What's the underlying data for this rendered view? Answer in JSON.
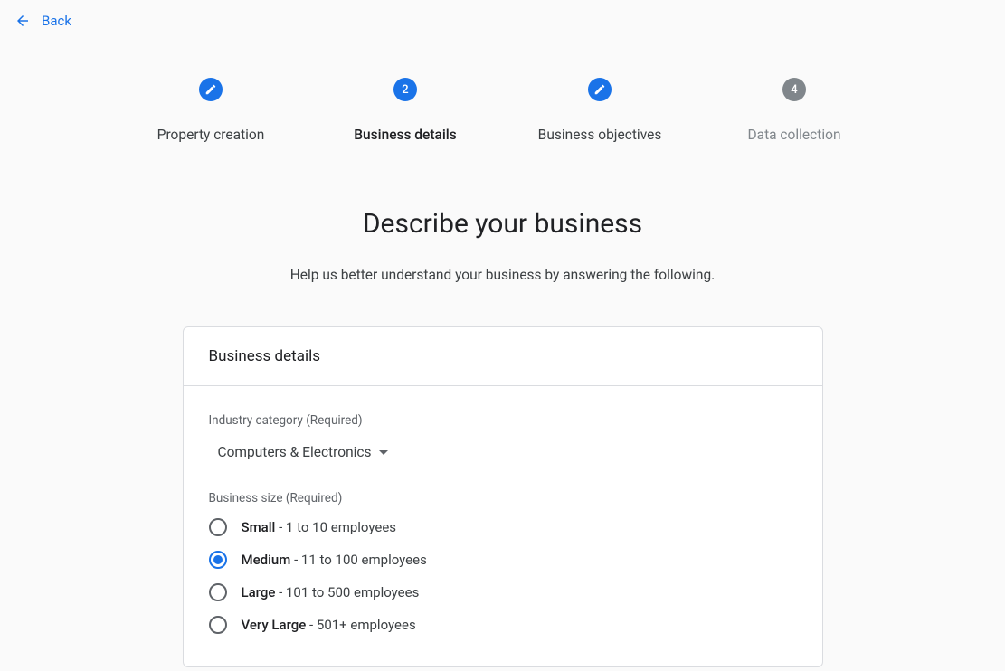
{
  "back": {
    "label": "Back"
  },
  "stepper": {
    "steps": [
      {
        "label": "Property creation",
        "type": "edit",
        "state": "done"
      },
      {
        "label": "Business details",
        "type": "number",
        "number": "2",
        "state": "active"
      },
      {
        "label": "Business objectives",
        "type": "edit",
        "state": "done"
      },
      {
        "label": "Data collection",
        "type": "number",
        "number": "4",
        "state": "future"
      }
    ]
  },
  "page": {
    "title": "Describe your business",
    "subtitle": "Help us better understand your business by answering the following."
  },
  "card": {
    "title": "Business details",
    "industry": {
      "label": "Industry category (Required)",
      "value": "Computers & Electronics"
    },
    "size": {
      "label": "Business size (Required)",
      "selected": "medium",
      "options": [
        {
          "id": "small",
          "name": "Small",
          "desc": " - 1 to 10 employees"
        },
        {
          "id": "medium",
          "name": "Medium",
          "desc": " - 11 to 100 employees"
        },
        {
          "id": "large",
          "name": "Large",
          "desc": " - 101 to 500 employees"
        },
        {
          "id": "very-large",
          "name": "Very Large",
          "desc": " - 501+ employees"
        }
      ]
    }
  }
}
